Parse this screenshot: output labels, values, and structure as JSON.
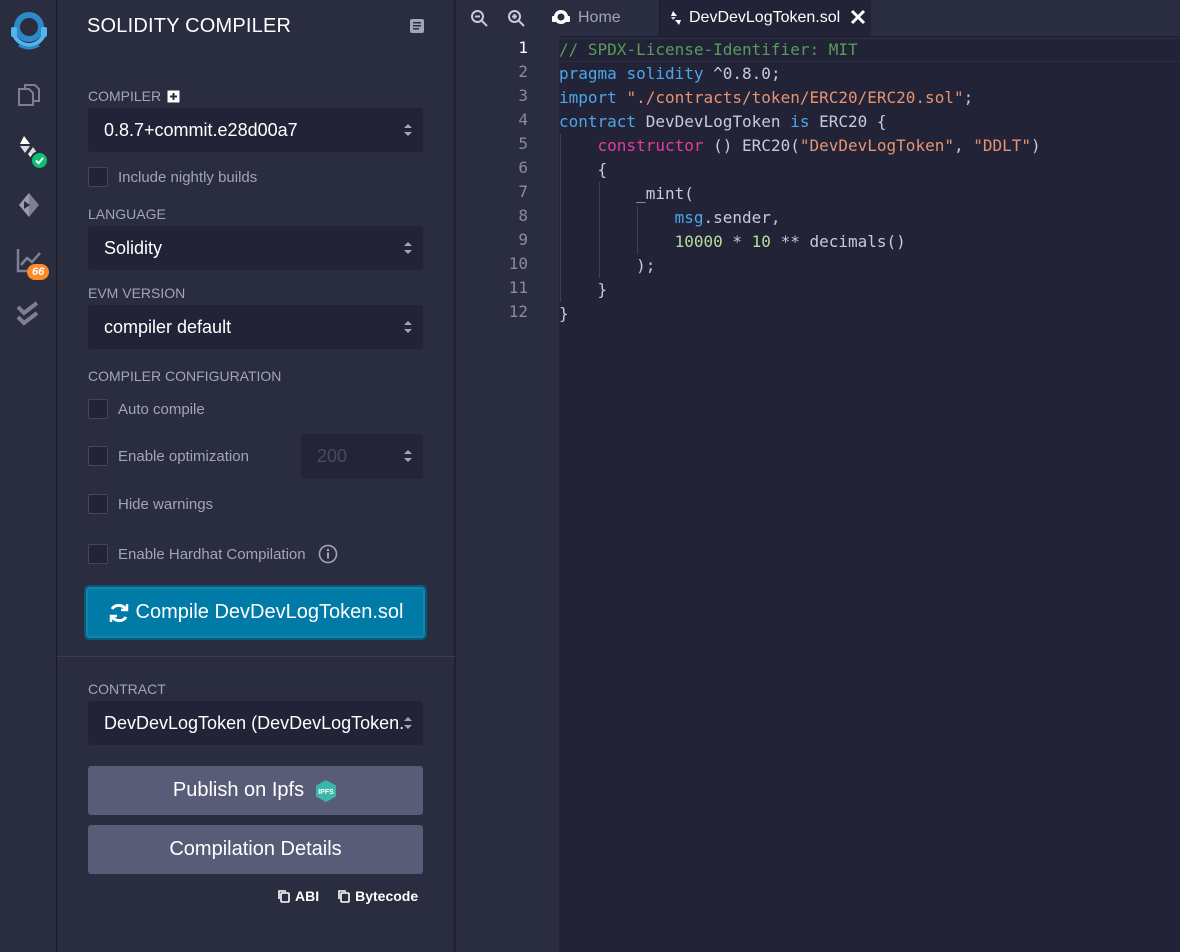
{
  "iconbar": {
    "analysis_badge": "66"
  },
  "panel": {
    "title": "SOLIDITY COMPILER",
    "compiler_label": "COMPILER",
    "compiler_value": "0.8.7+commit.e28d00a7",
    "nightly_label": "Include nightly builds",
    "language_label": "LANGUAGE",
    "language_value": "Solidity",
    "evm_label": "EVM VERSION",
    "evm_value": "compiler default",
    "config_label": "COMPILER CONFIGURATION",
    "auto_compile_label": "Auto compile",
    "optimization_label": "Enable optimization",
    "runs_value": "200",
    "hide_warnings_label": "Hide warnings",
    "hardhat_label": "Enable Hardhat Compilation",
    "compile_button": "Compile DevDevLogToken.sol",
    "contract_label": "CONTRACT",
    "contract_value": "DevDevLogToken (DevDevLogToken.sol)",
    "publish_button": "Publish on Ipfs",
    "ipfs_badge_text": "IPFS",
    "details_button": "Compilation Details",
    "abi_label": "ABI",
    "bytecode_label": "Bytecode"
  },
  "editor": {
    "tabs": [
      {
        "label": "Home"
      },
      {
        "label": "DevDevLogToken.sol"
      }
    ],
    "line_numbers": [
      "1",
      "2",
      "3",
      "4",
      "5",
      "6",
      "7",
      "8",
      "9",
      "10",
      "11",
      "12"
    ],
    "code": {
      "l1_comment": "// SPDX-License-Identifier: MIT",
      "l2_kw1": "pragma",
      "l2_kw2": "solidity",
      "l2_ver": "^0.8.0;",
      "l3_kw": "import",
      "l3_str": "\"./contracts/token/ERC20/ERC20.sol\"",
      "l3_end": ";",
      "l4_kw": "contract",
      "l4_name": "DevDevLogToken",
      "l4_is": "is",
      "l4_rest": "ERC20 {",
      "l5_kw": "constructor",
      "l5_mid": "() ERC20(",
      "l5_str1": "\"DevDevLogToken\"",
      "l5_comma": ", ",
      "l5_str2": "\"DDLT\"",
      "l5_end": ")",
      "l6": "{",
      "l7": "_mint(",
      "l8_kw": "msg",
      "l8_rest": ".sender,",
      "l9_num1": "10000",
      "l9_op1": " * ",
      "l9_num2": "10",
      "l9_rest": " ** decimals()",
      "l10": ");",
      "l11": "}",
      "l12": "}"
    }
  }
}
